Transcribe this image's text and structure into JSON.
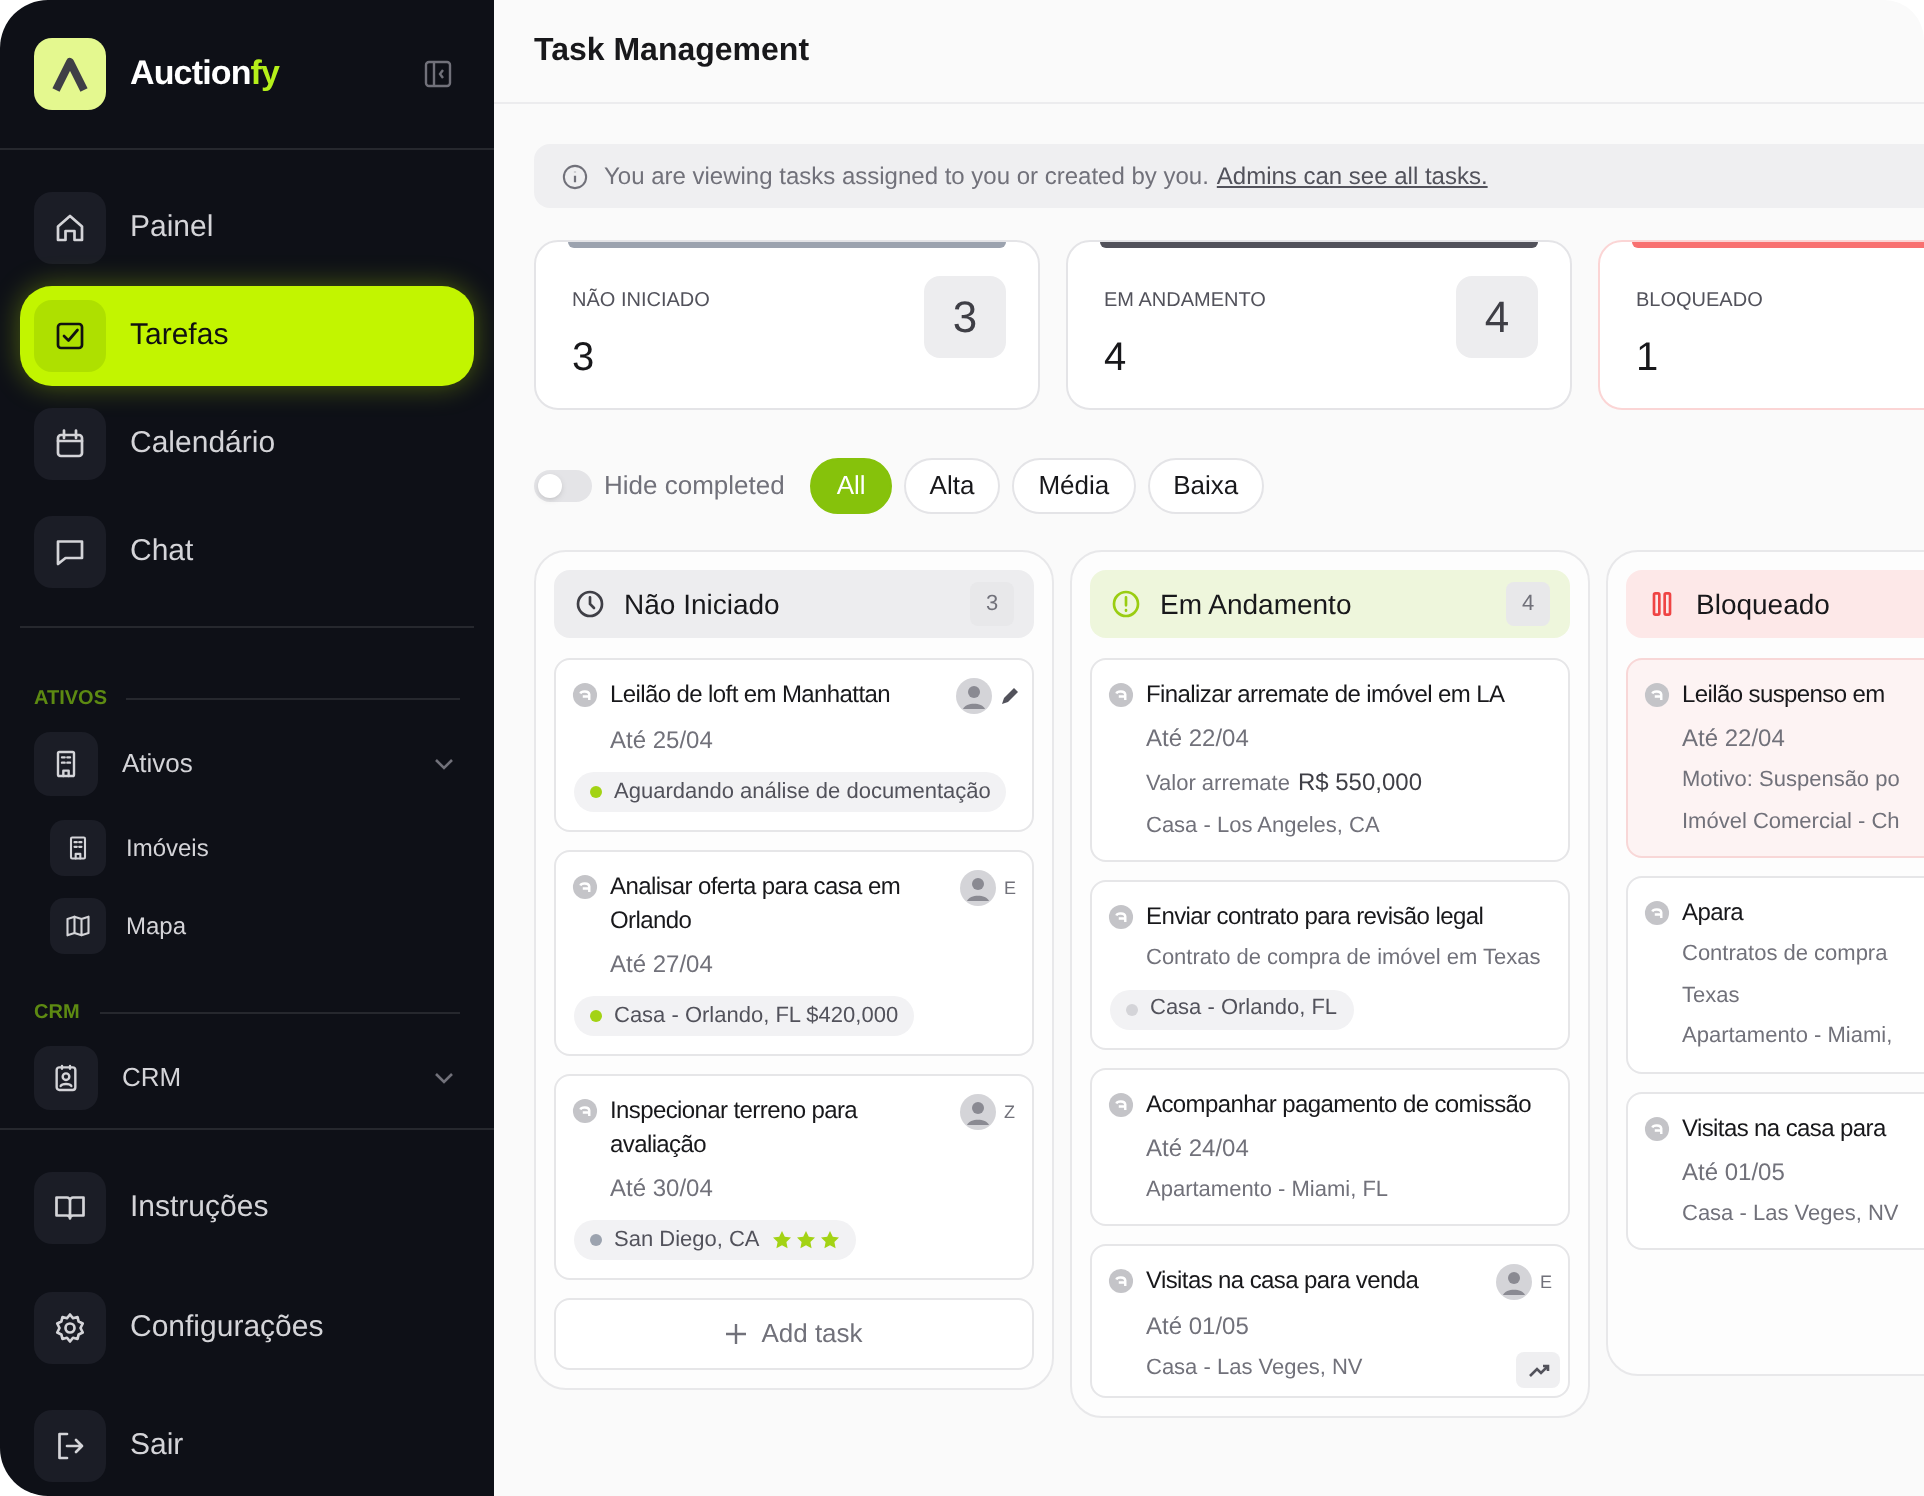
{
  "sidebar": {
    "brand": {
      "name": "Auction",
      "accent": "fy"
    },
    "nav": [
      {
        "label": "Painel",
        "selected": false
      },
      {
        "label": "Tarefas",
        "selected": true
      },
      {
        "label": "Calendário",
        "selected": false
      },
      {
        "label": "Chat",
        "selected": false
      }
    ],
    "sections": [
      {
        "heading": "ATIVOS",
        "items": [
          {
            "label": "Ativos",
            "children": [
              {
                "label": "Imóveis"
              },
              {
                "label": "Mapa"
              }
            ]
          }
        ]
      },
      {
        "heading": "CRM",
        "items": [
          {
            "label": "CRM"
          }
        ]
      }
    ],
    "footer": [
      {
        "label": "Instruções"
      },
      {
        "label": "Configurações"
      },
      {
        "label": "Sair"
      }
    ]
  },
  "header": {
    "title": "Task Management"
  },
  "notice": {
    "text": "You are viewing tasks assigned to you or created by you.",
    "link": "Admins can see all tasks."
  },
  "stats": [
    {
      "label": "NÃO INICIADO",
      "value": "3",
      "badge": "3",
      "color": "#9ca3af",
      "alert": false
    },
    {
      "label": "EM ANDAMENTO",
      "value": "4",
      "badge": "4",
      "color": "#52525b",
      "alert": false
    },
    {
      "label": "BLOQUEADO",
      "value": "1",
      "color": "#f87171",
      "alert": true
    }
  ],
  "filters": {
    "hide_completed": {
      "label": "Hide completed",
      "on": false
    },
    "chips": [
      {
        "label": "All",
        "selected": true
      },
      {
        "label": "Alta",
        "selected": false
      },
      {
        "label": "Média",
        "selected": false
      },
      {
        "label": "Baixa",
        "selected": false
      }
    ]
  },
  "columns": [
    {
      "title": "Não Iniciado",
      "count": "3",
      "add_label": "Add task",
      "cards": [
        {
          "title": "Leilão de loft em Manhattan",
          "blocked": false,
          "avatar": true,
          "trend_button": false,
          "assignee": {
            "kind": "pencil"
          },
          "lines": [
            {
              "kind": "due",
              "text": "Até 25/04"
            },
            {
              "kind": "tag",
              "text": "Aguardando análise de documentação",
              "color": "#a3d314"
            }
          ]
        },
        {
          "title": "Analisar oferta para casa em Orlando",
          "blocked": false,
          "avatar": true,
          "trend_button": false,
          "assignee": {
            "kind": "letter",
            "text": "E"
          },
          "lines": [
            {
              "kind": "due",
              "text": "Até 27/04"
            },
            {
              "kind": "tag",
              "text": "Casa - Orlando, FL $420,000",
              "color": "#a3d314"
            }
          ]
        },
        {
          "title": "Inspecionar terreno para avaliação",
          "blocked": false,
          "avatar": true,
          "trend_button": false,
          "assignee": {
            "kind": "letter",
            "text": "Z"
          },
          "lines": [
            {
              "kind": "due",
              "text": "Até 30/04"
            },
            {
              "kind": "tag",
              "text": "San Diego, CA",
              "color": "#9ca3af",
              "stars": 3
            }
          ]
        }
      ]
    },
    {
      "title": "Em Andamento",
      "count": "4",
      "cards": [
        {
          "title": "Finalizar arremate de imóvel em LA",
          "blocked": false,
          "avatar": false,
          "trend_button": false,
          "lines": [
            {
              "kind": "due",
              "text": "Até 22/04"
            },
            {
              "kind": "value",
              "label": "Valor arremate",
              "amount": "R$ 550,000"
            },
            {
              "kind": "text",
              "text": "Casa - Los Angeles, CA"
            }
          ]
        },
        {
          "title": "Enviar contrato para revisão legal",
          "blocked": false,
          "avatar": false,
          "trend_button": false,
          "lines": [
            {
              "kind": "text",
              "text": "Contrato de compra de imóvel em Texas"
            },
            {
              "kind": "tag",
              "text": "Casa - Orlando, FL",
              "color": "#d4d4d8"
            }
          ]
        },
        {
          "title": "Acompanhar pagamento de comissão",
          "blocked": false,
          "avatar": false,
          "trend_button": false,
          "lines": [
            {
              "kind": "due",
              "text": "Até 24/04"
            },
            {
              "kind": "text",
              "text": "Apartamento - Miami, FL"
            }
          ]
        },
        {
          "title": "Visitas na casa para venda",
          "blocked": false,
          "avatar": true,
          "trend_button": true,
          "assignee": {
            "kind": "letter",
            "text": "E"
          },
          "lines": [
            {
              "kind": "due",
              "text": "Até 01/05"
            },
            {
              "kind": "text",
              "text": "Casa - Las Veges, NV"
            }
          ]
        }
      ]
    },
    {
      "title": "Bloqueado",
      "cards": [
        {
          "title": "Leilão suspenso em",
          "blocked": true,
          "avatar": false,
          "trend_button": false,
          "lines": [
            {
              "kind": "due",
              "text": "Até 22/04"
            },
            {
              "kind": "text",
              "text": "Motivo: Suspensão po"
            },
            {
              "kind": "text",
              "text": "Imóvel Comercial - Ch"
            }
          ]
        },
        {
          "title": "Apara",
          "blocked": false,
          "avatar": false,
          "trend_button": false,
          "lines": [
            {
              "kind": "text",
              "text": "Contratos de compra"
            },
            {
              "kind": "text",
              "text": "Texas"
            },
            {
              "kind": "text",
              "text": "Apartamento - Miami,"
            }
          ]
        },
        {
          "title": "Visitas na casa para",
          "blocked": false,
          "avatar": false,
          "trend_button": false,
          "lines": [
            {
              "kind": "due",
              "text": "Até 01/05"
            },
            {
              "kind": "text",
              "text": "Casa - Las Veges, NV"
            }
          ]
        }
      ]
    }
  ]
}
